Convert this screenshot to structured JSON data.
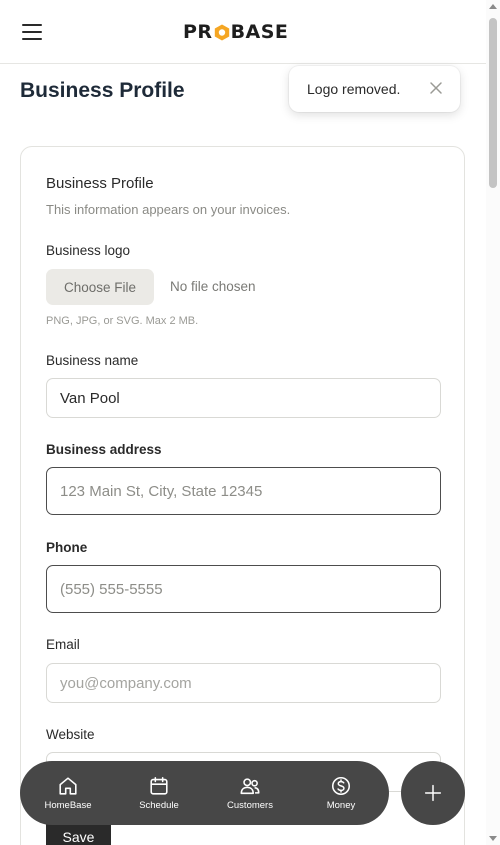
{
  "header": {
    "menu_icon": "hamburger-menu-icon",
    "logo_part1": "PR",
    "logo_part2": "BASE",
    "logo_mark": "hexagon-o-icon",
    "logo_color": "#f5a623"
  },
  "page": {
    "title": "Business Profile"
  },
  "toast": {
    "message": "Logo removed.",
    "close_icon": "close-icon"
  },
  "card": {
    "title": "Business Profile",
    "subtitle": "This information appears on your invoices."
  },
  "form": {
    "logo": {
      "label": "Business logo",
      "button_label": "Choose File",
      "status": "No file chosen",
      "hint": "PNG, JPG, or SVG. Max 2 MB."
    },
    "name": {
      "label": "Business name",
      "value": "Van Pool"
    },
    "address": {
      "label": "Business address",
      "placeholder": "123 Main St, City, State 12345"
    },
    "phone": {
      "label": "Phone",
      "placeholder": "(555) 555-5555"
    },
    "email": {
      "label": "Email",
      "placeholder": "you@company.com"
    },
    "website": {
      "label": "Website"
    },
    "save_label": "Save"
  },
  "bottom_nav": {
    "items": [
      {
        "label": "HomeBase",
        "icon": "home-icon"
      },
      {
        "label": "Schedule",
        "icon": "calendar-icon"
      },
      {
        "label": "Customers",
        "icon": "users-icon"
      },
      {
        "label": "Money",
        "icon": "dollar-circle-icon"
      }
    ],
    "fab_icon": "plus-icon"
  },
  "colors": {
    "accent": "#f5a623",
    "nav_bg": "#474747",
    "text_dark": "#1e2a38"
  }
}
